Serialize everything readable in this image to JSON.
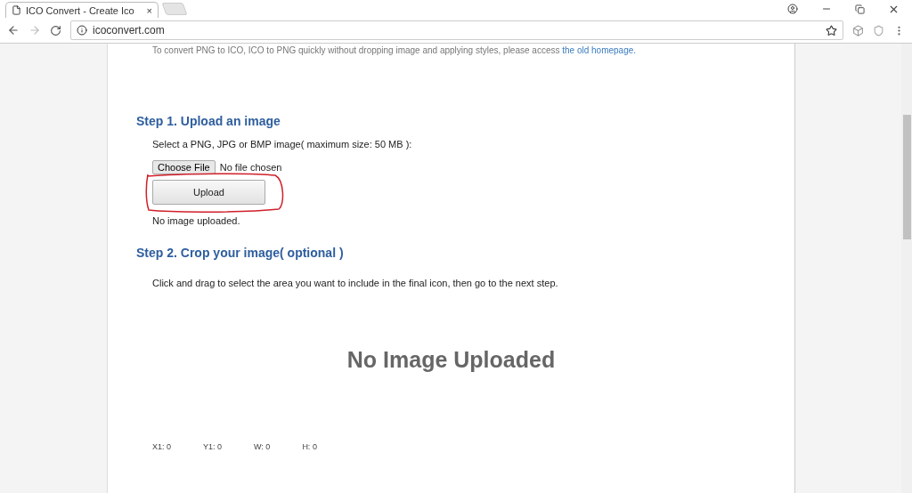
{
  "browser": {
    "tab_title": "ICO Convert - Create Ico",
    "tab_close": "×",
    "url": "icoconvert.com"
  },
  "page": {
    "intro": "To convert PNG to ICO, ICO to PNG quickly without dropping image and applying styles, please access ",
    "intro_link": "the old homepage.",
    "step1": {
      "heading": "Step 1. Upload an image",
      "instruction": "Select a PNG, JPG or BMP image( maximum size: 50 MB ):",
      "choose_button": "Choose File",
      "file_status": "No file chosen",
      "upload_button": "Upload",
      "upload_highlighted": true,
      "upload_status": "No image uploaded."
    },
    "step2": {
      "heading": "Step 2. Crop your image( optional )",
      "instruction": "Click and drag to select the area you want to include in the final icon, then go to the next step.",
      "placeholder_message": "No Image Uploaded",
      "coords": [
        {
          "label": "X1: 0"
        },
        {
          "label": "Y1: 0"
        },
        {
          "label": "W: 0"
        },
        {
          "label": "H: 0"
        }
      ]
    }
  }
}
